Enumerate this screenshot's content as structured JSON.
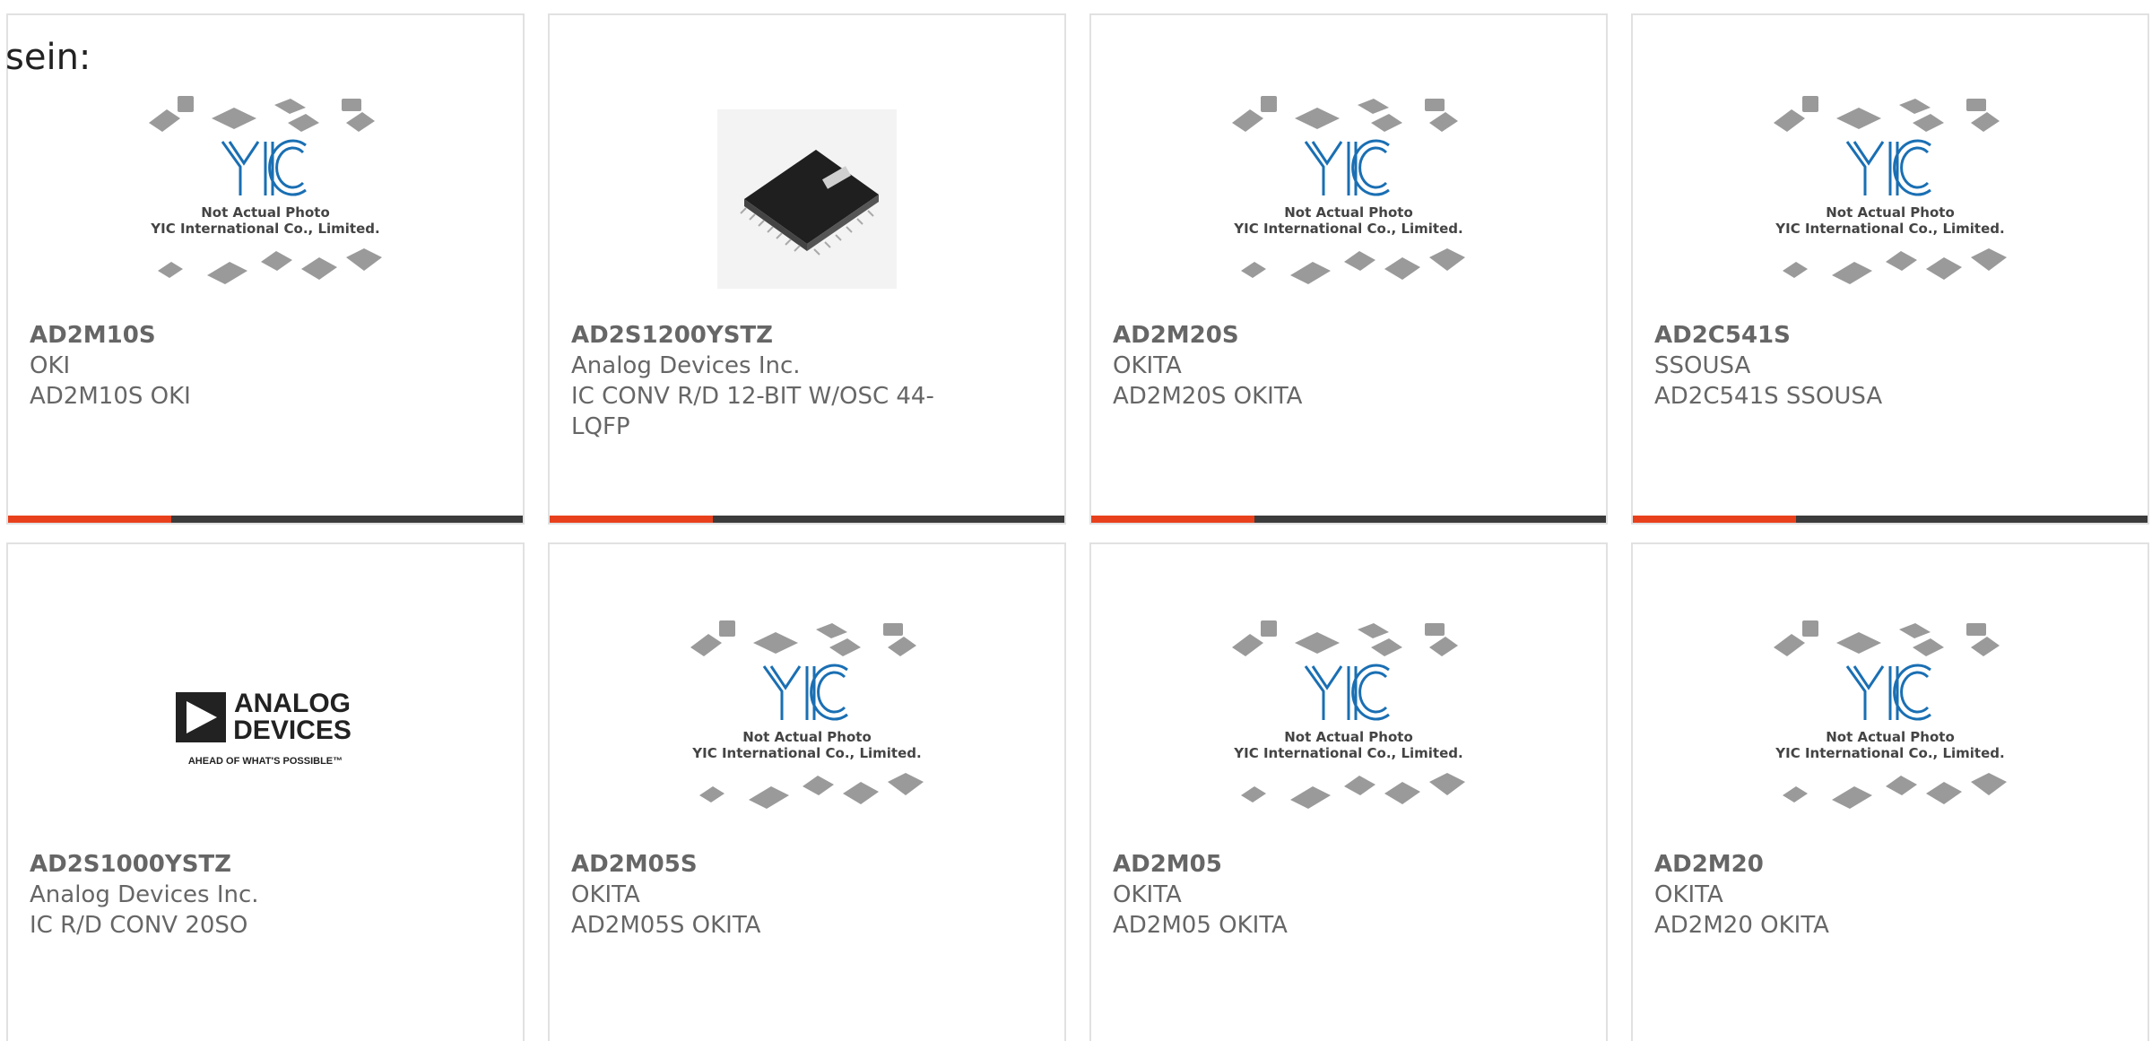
{
  "intro": {
    "text": "sein:"
  },
  "products": [
    {
      "part_number": "AD2M10S",
      "manufacturer": "OKI",
      "description": "AD2M10S OKI",
      "image": "yic-placeholder",
      "placeholder_line1": "Not Actual Photo",
      "placeholder_line2": "YIC International Co., Limited."
    },
    {
      "part_number": "AD2S1200YSTZ",
      "manufacturer": "Analog Devices Inc.",
      "description": "IC CONV R/D 12-BIT W/OSC 44-LQFP",
      "image": "lqfp-chip-photo"
    },
    {
      "part_number": "AD2M20S",
      "manufacturer": "OKITA",
      "description": "AD2M20S OKITA",
      "image": "yic-placeholder",
      "placeholder_line1": "Not Actual Photo",
      "placeholder_line2": "YIC International Co., Limited."
    },
    {
      "part_number": "AD2C541S",
      "manufacturer": "SSOUSA",
      "description": "AD2C541S SSOUSA",
      "image": "yic-placeholder",
      "placeholder_line1": "Not Actual Photo",
      "placeholder_line2": "YIC International Co., Limited."
    },
    {
      "part_number": "AD2S1000YSTZ",
      "manufacturer": "Analog Devices Inc.",
      "description": "IC R/D CONV 20SO",
      "image": "analog-devices-logo",
      "logo_line1": "ANALOG",
      "logo_line2": "DEVICES",
      "logo_tagline": "AHEAD OF WHAT'S POSSIBLE™"
    },
    {
      "part_number": "AD2M05S",
      "manufacturer": "OKITA",
      "description": "AD2M05S OKITA",
      "image": "yic-placeholder",
      "placeholder_line1": "Not Actual Photo",
      "placeholder_line2": "YIC International Co., Limited."
    },
    {
      "part_number": "AD2M05",
      "manufacturer": "OKITA",
      "description": "AD2M05 OKITA",
      "image": "yic-placeholder",
      "placeholder_line1": "Not Actual Photo",
      "placeholder_line2": "YIC International Co., Limited."
    },
    {
      "part_number": "AD2M20",
      "manufacturer": "OKITA",
      "description": "AD2M20 OKITA",
      "image": "yic-placeholder",
      "placeholder_line1": "Not Actual Photo",
      "placeholder_line2": "YIC International Co., Limited."
    }
  ],
  "colors": {
    "accent": "#e8401c",
    "bar": "#3b3b3b",
    "text": "#666666",
    "border": "#e1e1e1",
    "yic_logo": "#1a6fb3"
  }
}
